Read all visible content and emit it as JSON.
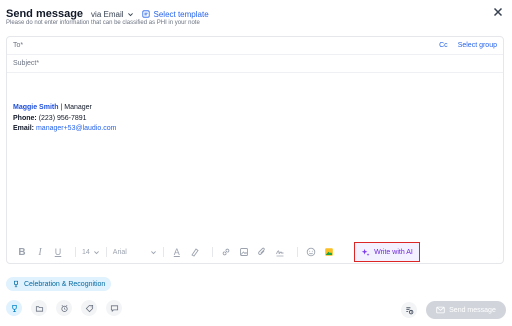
{
  "header": {
    "title": "Send message",
    "via": "via Email",
    "select_template": "Select template",
    "subtitle": "Please do not enter information that can be classified as PHI in your note"
  },
  "fields": {
    "to_label": "To*",
    "subject_label": "Subject*",
    "cc": "Cc",
    "select_group": "Select group"
  },
  "signature": {
    "name": "Maggie Smith",
    "role": "| Manager",
    "phone_label": "Phone:",
    "phone": "(223) 956-7891",
    "email_label": "Email:",
    "email": "manager+53@laudio.com"
  },
  "toolbar": {
    "font_size": "14",
    "font_family": "Arial",
    "write_with_ai": "Write with AI"
  },
  "tag_chip": "Celebration & Recognition",
  "bottom": {
    "send": "Send message"
  },
  "colors": {
    "accent": "#2563eb",
    "ai_border": "#dc2626",
    "ai_text": "#6d28d9",
    "chip_bg": "#e0f2fe"
  }
}
